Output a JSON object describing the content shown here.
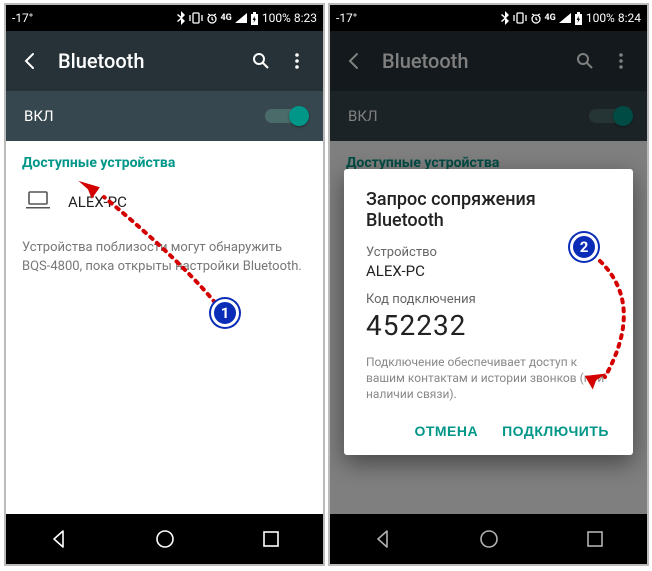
{
  "left": {
    "statusbar": {
      "temp": "-17°",
      "battery_pct": "100%",
      "time": "8:23"
    },
    "appbar": {
      "title": "Bluetooth"
    },
    "toggle": {
      "label": "ВКЛ",
      "on": true
    },
    "section_title": "Доступные устройства",
    "device": {
      "name": "ALEX-PC"
    },
    "hint": "Устройства поблизости могут обнаружить BQS-4800, пока открыты настройки Bluetooth."
  },
  "right": {
    "statusbar": {
      "temp": "-17°",
      "battery_pct": "100%",
      "time": "8:24"
    },
    "appbar": {
      "title": "Bluetooth"
    },
    "toggle": {
      "label": "ВКЛ",
      "on": true
    },
    "section_title": "Доступные устройства",
    "dialog": {
      "title": "Запрос сопряжения Bluetooth",
      "device_label": "Устройство",
      "device_value": "ALEX-PC",
      "code_label": "Код подключения",
      "code_value": "452232",
      "note": "Подключение обеспечивает доступ к вашим контактам и истории звонков (при наличии связи).",
      "cancel": "ОТМЕНА",
      "connect": "ПОДКЛЮЧИТЬ"
    }
  },
  "annotations": {
    "badge1": "1",
    "badge2": "2"
  }
}
